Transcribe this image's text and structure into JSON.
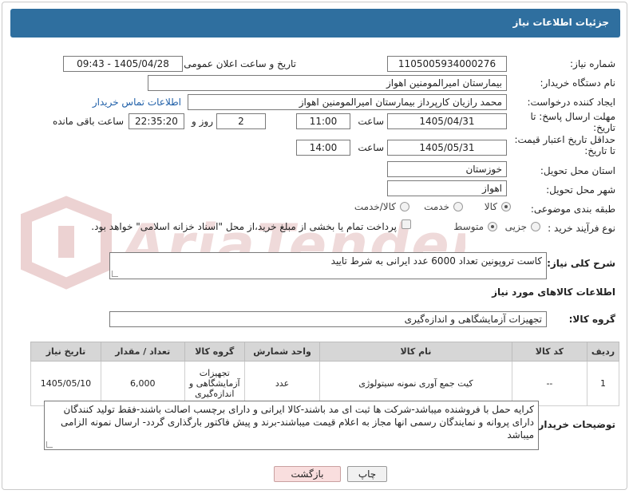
{
  "header": {
    "title": "جزئیات اطلاعات نیاز"
  },
  "form": {
    "need_number": {
      "label": "شماره نیاز:",
      "value": "1105005934000276"
    },
    "announce_date": {
      "label": "تاریخ و ساعت اعلان عمومی:",
      "value": "1405/04/28 - 09:43"
    },
    "buyer_org": {
      "label": "نام دستگاه خریدار:",
      "value": "بیمارستان امیرالمومنین اهواز"
    },
    "requester": {
      "label": "ایجاد کننده درخواست:",
      "value": "محمد رازیان کارپرداز بیمارستان امیرالمومنین اهواز",
      "contact_link": "اطلاعات تماس خریدار"
    },
    "reply_deadline": {
      "label_line1": "مهلت ارسال پاسخ: تا",
      "label_line2": "تاریخ:",
      "date": "1405/04/31",
      "time_label": "ساعت",
      "time": "11:00",
      "days": "2",
      "days_label": "روز و",
      "remaining": "22:35:20",
      "remaining_label": "ساعت باقی مانده"
    },
    "price_validity": {
      "label_line1": "حداقل تاریخ اعتبار قیمت:",
      "label_line2": "تا تاریخ:",
      "date": "1405/05/31",
      "time_label": "ساعت",
      "time": "14:00"
    },
    "province": {
      "label": "استان محل تحویل:",
      "value": "خوزستان"
    },
    "city": {
      "label": "شهر محل تحویل:",
      "value": "اهواز"
    },
    "category": {
      "label": "طبقه بندی موضوعی:",
      "options": [
        "کالا",
        "خدمت",
        "کالا/خدمت"
      ],
      "selected": "کالا"
    },
    "process": {
      "label": "نوع فرآیند خرید :",
      "options": [
        "جزیی",
        "متوسط"
      ],
      "selected": "متوسط",
      "treasury_note": "پرداخت تمام یا بخشی از مبلغ خرید،از محل \"اسناد خزانه اسلامی\" خواهد بود."
    }
  },
  "description": {
    "label": "شرح کلی نیاز:",
    "value": "کاست تروپونین تعداد 6000 عدد ایرانی به شرط تایید"
  },
  "goods_section": {
    "title": "اطلاعات کالاهای مورد نیاز",
    "group_label": "گروه کالا:",
    "group_value": "تجهیزات آزمایشگاهی و اندازه‌گیری"
  },
  "table": {
    "headers": [
      "ردیف",
      "کد کالا",
      "نام کالا",
      "واحد شمارش",
      "گروه کالا",
      "تعداد / مقدار",
      "تاریخ نیاز"
    ],
    "rows": [
      {
        "row": "1",
        "code": "--",
        "name": "کیت جمع آوری نمونه سیتولوژی",
        "unit": "عدد",
        "group": "تجهیزات آزمایشگاهی و اندازه‌گیری",
        "qty": "6,000",
        "date": "1405/05/10"
      }
    ]
  },
  "buyer_notes": {
    "label": "توضیحات خریدار:",
    "value": "کرایه حمل با فروشنده میباشد-شرکت ها ثبت ای مد باشند-کالا ایرانی و دارای برچسب اصالت باشند-فقط تولید کنندگان دارای پروانه و نمایندگان رسمی انها مجاز به اعلام قیمت میباشند-برند و پیش فاکتور بارگذاری گردد- ارسال نمونه الزامی میباشد"
  },
  "buttons": {
    "print": "چاپ",
    "back": "بازگشت"
  },
  "watermark": {
    "text": "AriaTender.neT"
  },
  "colors": {
    "header": "#2f6f9f",
    "link": "#1f5fa8",
    "watermark": "#e9c9c9"
  }
}
